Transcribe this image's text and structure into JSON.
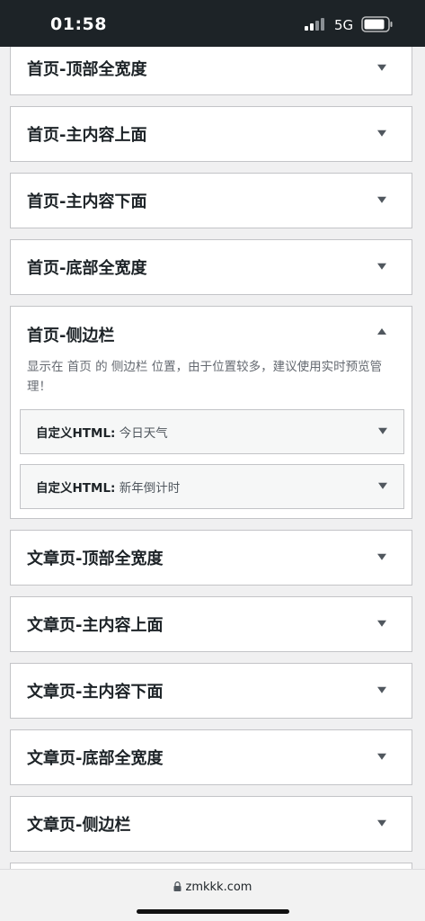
{
  "status_bar": {
    "time": "01:58",
    "network": "5G"
  },
  "sections_top": [
    {
      "title": "首页-顶部全宽度"
    },
    {
      "title": "首页-主内容上面"
    },
    {
      "title": "首页-主内容下面"
    },
    {
      "title": "首页-底部全宽度"
    }
  ],
  "expanded_section": {
    "title": "首页-侧边栏",
    "description": "显示在 首页 的 侧边栏 位置，由于位置较多，建议使用实时预览管理！",
    "widgets": [
      {
        "type": "自定义HTML:",
        "name": "今日天气"
      },
      {
        "type": "自定义HTML:",
        "name": "新年倒计时"
      }
    ]
  },
  "sections_bottom": [
    {
      "title": "文章页-顶部全宽度"
    },
    {
      "title": "文章页-主内容上面"
    },
    {
      "title": "文章页-主内容下面"
    },
    {
      "title": "文章页-底部全宽度"
    },
    {
      "title": "文章页-侧边栏"
    }
  ],
  "browser": {
    "url": "zmkkk.com"
  }
}
